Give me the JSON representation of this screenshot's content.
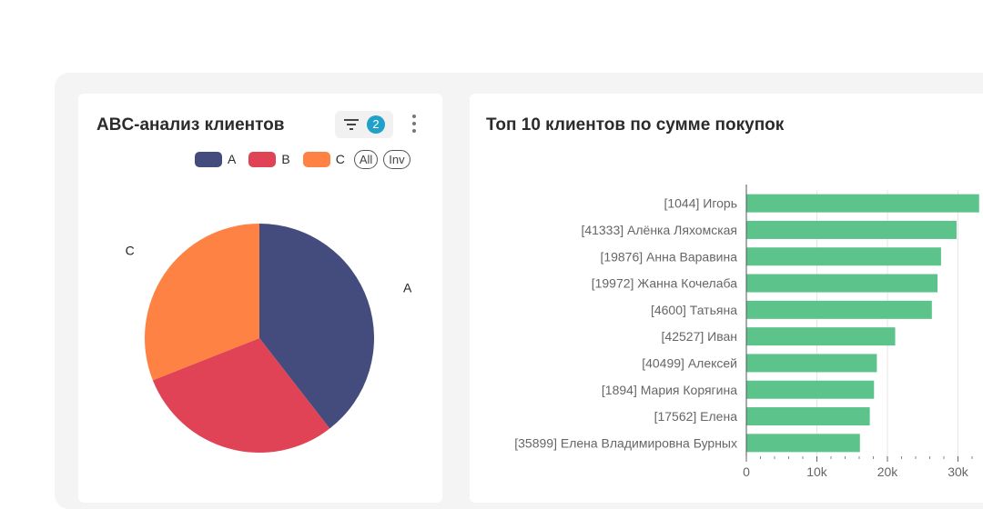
{
  "pie_card": {
    "title": "ABC-анализ клиентов",
    "filter_count": "2",
    "legend_all": "All",
    "legend_inv": "Inv"
  },
  "bar_card": {
    "title": "Топ 10 клиентов по сумме покупок"
  },
  "colors": {
    "A": "#434c7c",
    "B": "#e04356",
    "C": "#fe8243",
    "bar": "#5cc48a",
    "accent": "#21a0c9"
  },
  "chart_data": [
    {
      "type": "pie",
      "categories": [
        "A",
        "B",
        "C"
      ],
      "values": [
        39.5,
        29.5,
        31.0
      ]
    },
    {
      "type": "bar",
      "orientation": "horizontal",
      "categories": [
        "[1044] Игорь",
        "[41333] Алёнка Ляхомская",
        "[19876] Анна Варавина",
        "[19972] Жанна Кочелаба",
        "[4600] Татьяна",
        "[42527] Иван",
        "[40499] Алексей",
        "[1894] Мария Корягина",
        "[17562] Елена",
        "[35899] Елена Владимировна Бурных"
      ],
      "values": [
        33000,
        29800,
        27600,
        27100,
        26300,
        21100,
        18500,
        18100,
        17500,
        16100
      ],
      "xticks": [
        0,
        10000,
        20000,
        30000
      ],
      "xtick_labels": [
        "0",
        "10k",
        "20k",
        "30k"
      ],
      "xlim": [
        0,
        33000
      ],
      "grid": true
    }
  ]
}
